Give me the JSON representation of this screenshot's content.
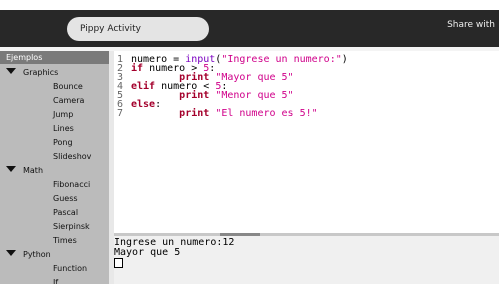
{
  "toolbar": {
    "activity_title": "Pippy Activity",
    "share_label": "Share with"
  },
  "sidebar": {
    "header": "Ejemplos",
    "items": [
      {
        "kind": "category",
        "label": "Graphics"
      },
      {
        "kind": "leaf",
        "label": "Bounce"
      },
      {
        "kind": "leaf",
        "label": "Camera"
      },
      {
        "kind": "leaf",
        "label": "Jump"
      },
      {
        "kind": "leaf",
        "label": "Lines"
      },
      {
        "kind": "leaf",
        "label": "Pong"
      },
      {
        "kind": "leaf",
        "label": "Slideshov"
      },
      {
        "kind": "category",
        "label": "Math"
      },
      {
        "kind": "leaf",
        "label": "Fibonacci"
      },
      {
        "kind": "leaf",
        "label": "Guess"
      },
      {
        "kind": "leaf",
        "label": "Pascal"
      },
      {
        "kind": "leaf",
        "label": "Sierpinsk"
      },
      {
        "kind": "leaf",
        "label": "Times"
      },
      {
        "kind": "category",
        "label": "Python"
      },
      {
        "kind": "leaf",
        "label": "Function"
      },
      {
        "kind": "leaf",
        "label": "If"
      }
    ]
  },
  "editor": {
    "lines": [
      {
        "num": "1",
        "tokens": [
          {
            "t": "numero = ",
            "c": "pl"
          },
          {
            "t": "input",
            "c": "bi"
          },
          {
            "t": "(",
            "c": "pl"
          },
          {
            "t": "\"Ingrese un numero:\"",
            "c": "st"
          },
          {
            "t": ")",
            "c": "pl"
          }
        ]
      },
      {
        "num": "2",
        "tokens": [
          {
            "t": "if",
            "c": "kw"
          },
          {
            "t": " numero > ",
            "c": "pl"
          },
          {
            "t": "5",
            "c": "st"
          },
          {
            "t": ":",
            "c": "pl"
          }
        ]
      },
      {
        "num": "3",
        "tokens": [
          {
            "t": "        ",
            "c": "pl"
          },
          {
            "t": "print",
            "c": "kw"
          },
          {
            "t": " ",
            "c": "pl"
          },
          {
            "t": "\"Mayor que 5\"",
            "c": "st"
          }
        ]
      },
      {
        "num": "4",
        "tokens": [
          {
            "t": "elif",
            "c": "kw"
          },
          {
            "t": " numero < ",
            "c": "pl"
          },
          {
            "t": "5",
            "c": "st"
          },
          {
            "t": ":",
            "c": "pl"
          }
        ]
      },
      {
        "num": "5",
        "tokens": [
          {
            "t": "        ",
            "c": "pl"
          },
          {
            "t": "print",
            "c": "kw"
          },
          {
            "t": " ",
            "c": "pl"
          },
          {
            "t": "\"Menor que 5\"",
            "c": "st"
          }
        ]
      },
      {
        "num": "6",
        "tokens": [
          {
            "t": "else",
            "c": "kw"
          },
          {
            "t": ":",
            "c": "pl"
          }
        ]
      },
      {
        "num": "7",
        "tokens": [
          {
            "t": "        ",
            "c": "pl"
          },
          {
            "t": "print",
            "c": "kw"
          },
          {
            "t": " ",
            "c": "pl"
          },
          {
            "t": "\"El numero es 5!\"",
            "c": "st"
          }
        ]
      }
    ]
  },
  "console": {
    "lines": [
      "Ingrese un numero:12",
      "Mayor que 5"
    ]
  }
}
